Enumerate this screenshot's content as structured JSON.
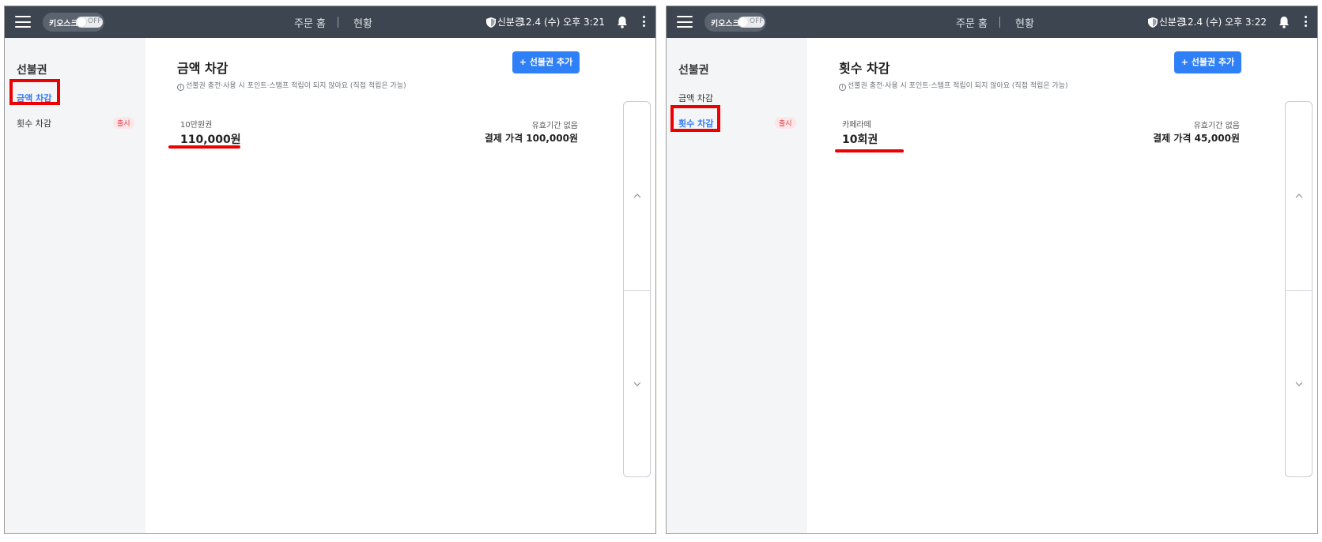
{
  "colors": {
    "topbar": "#3d4550",
    "sidebar": "#f4f5f7",
    "accent": "#2f80f6",
    "highlight": "#ee0000",
    "badge": "#e0404a"
  },
  "topbar": {
    "kiosk_label": "키오스크",
    "kiosk_state": "OFF",
    "nav_home": "주문 홈",
    "nav_status": "현황",
    "id_check": "신분증",
    "left_datetime": "12.4 (수) 오후 3:21",
    "right_datetime": "12.4 (수) 오후 3:22",
    "icons": [
      "menu-icon",
      "shield-icon",
      "bell-icon",
      "more-vertical-icon"
    ]
  },
  "sidebar": {
    "title": "선불권",
    "items": [
      {
        "label": "금액 차감"
      },
      {
        "label": "횟수 차감",
        "badge": "출시"
      }
    ]
  },
  "panels": [
    {
      "title": "금액 차감",
      "add_button": "+ 선불권 추가",
      "info": "선불권 충전·사용 시 포인트·스탬프 적립이 되지 않아요 (직접 적립은 가능)",
      "card": {
        "name": "10만원권",
        "amount": "110,000원",
        "validity": "유효기간 없음",
        "price": "결제 가격 100,000원"
      }
    },
    {
      "title": "횟수 차감",
      "add_button": "+ 선불권 추가",
      "info": "선불권 충전·사용 시 포인트·스탬프 적립이 되지 않아요 (직접 적립은 가능)",
      "card": {
        "name": "카페라떼",
        "amount": "10회권",
        "validity": "유효기간 없음",
        "price": "결제 가격 45,000원"
      }
    }
  ]
}
